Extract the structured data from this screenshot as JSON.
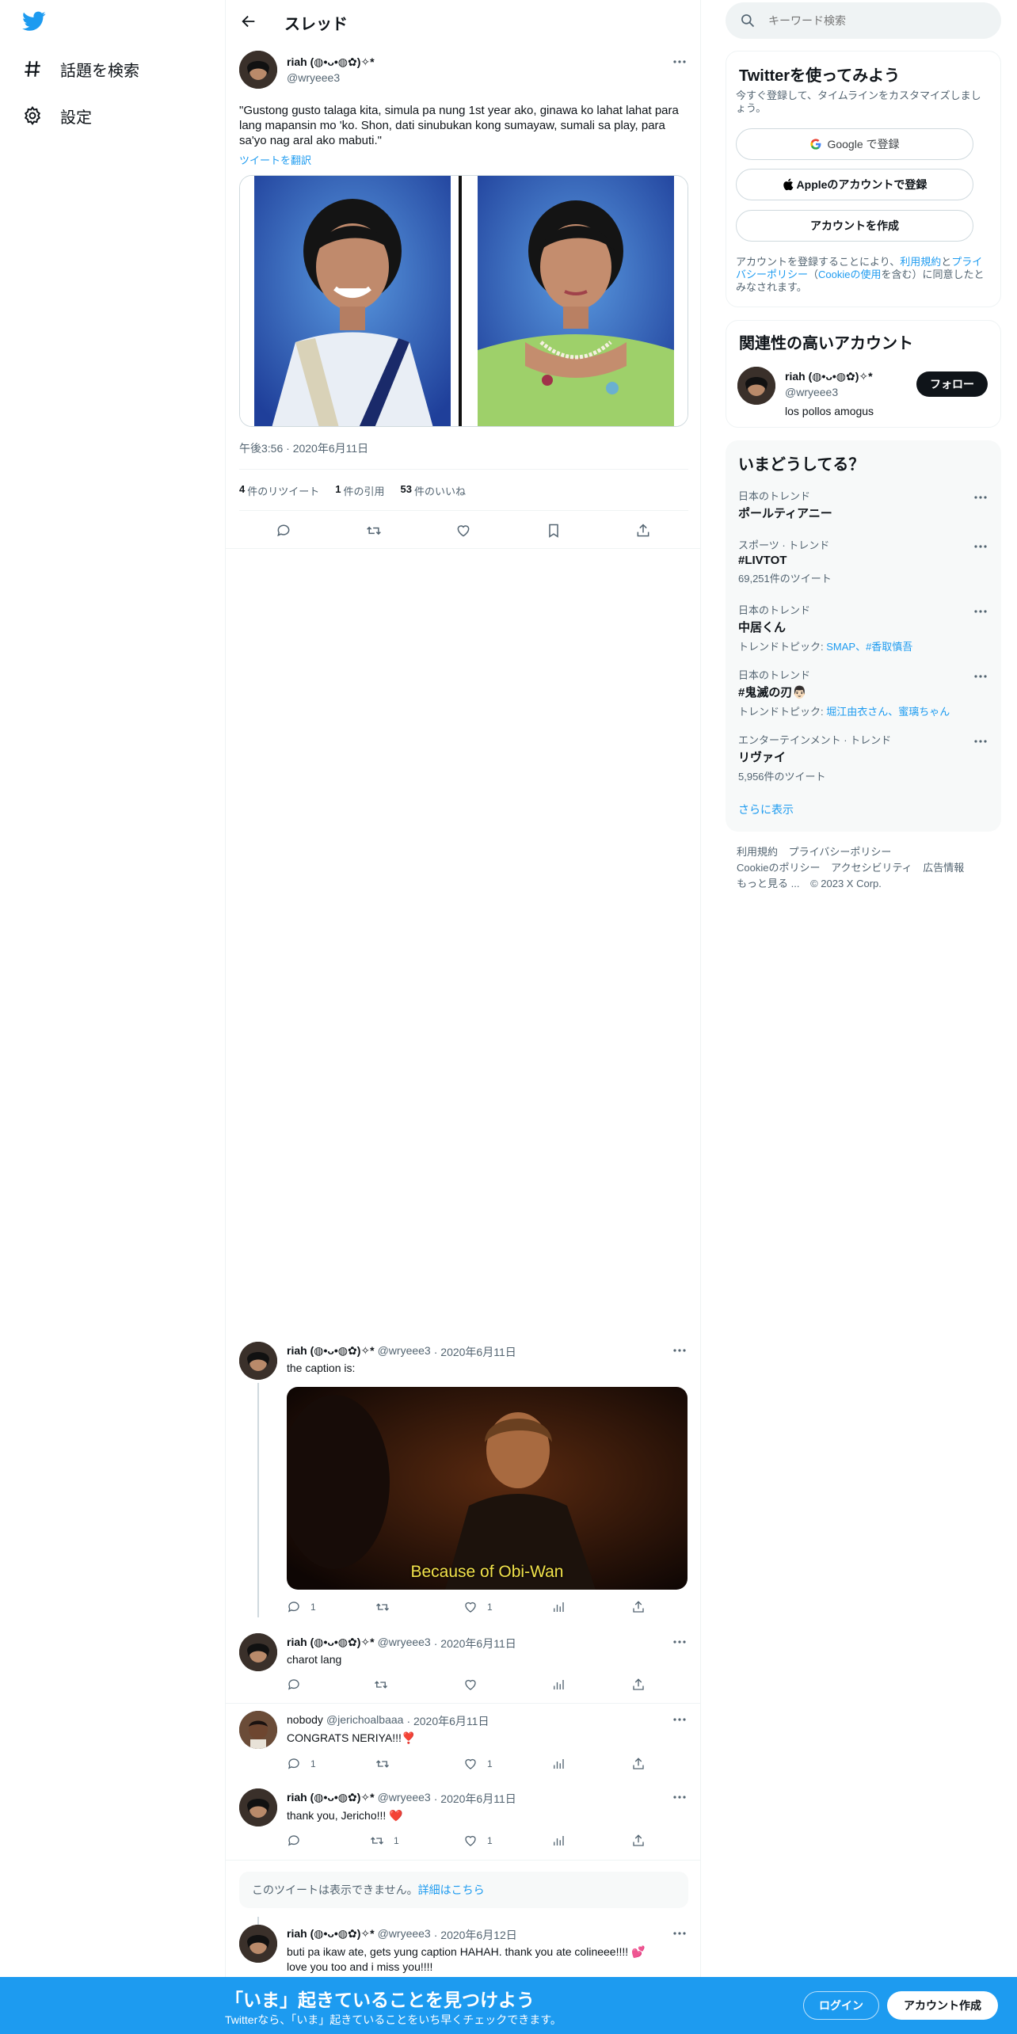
{
  "nav": {
    "explore_label": "話題を検索",
    "settings_label": "設定"
  },
  "header": {
    "title": "スレッド"
  },
  "main_tweet": {
    "name": "riah (◍•ᴗ•◍✿)✧*",
    "handle": "@wryeee3",
    "text": "\"Gustong gusto talaga kita, simula pa nung 1st year ako, ginawa ko lahat lahat para lang mapansin mo 'ko. Shon, dati sinubukan kong sumayaw, sumali sa play, para sa'yo nag aral ako mabuti.\"",
    "translate": "ツイートを翻訳",
    "timestamp": "午後3:56 · 2020年6月11日",
    "stats": {
      "retweets_count": "4",
      "retweets_label": "件のリツイート",
      "quotes_count": "1",
      "quotes_label": "件の引用",
      "likes_count": "53",
      "likes_label": "件のいいね"
    }
  },
  "replies": [
    {
      "name": "riah (◍•ᴗ•◍✿)✧*",
      "handle": "@wryeee3",
      "date": "· 2020年6月11日",
      "text": "the caption is:",
      "media_caption": "Because of Obi-Wan",
      "reply_count": "1",
      "retweet_count": "",
      "like_count": "1"
    },
    {
      "name": "riah (◍•ᴗ•◍✿)✧*",
      "handle": "@wryeee3",
      "date": "· 2020年6月11日",
      "text": "charot lang",
      "reply_count": "",
      "retweet_count": "",
      "like_count": ""
    },
    {
      "name": "nobody",
      "handle": "@jerichoalbaaa",
      "date": "· 2020年6月11日",
      "text": "CONGRATS NERIYA!!!❣️",
      "reply_count": "1",
      "retweet_count": "",
      "like_count": "1"
    },
    {
      "name": "riah (◍•ᴗ•◍✿)✧*",
      "handle": "@wryeee3",
      "date": "· 2020年6月11日",
      "text": "thank you, Jericho!!! ❤️",
      "reply_count": "",
      "retweet_count": "1",
      "like_count": "1"
    }
  ],
  "unavailable": {
    "text": "このツイートは表示できません。",
    "link": "詳細はこちら"
  },
  "last_reply": {
    "name": "riah (◍•ᴗ•◍✿)✧*",
    "handle": "@wryeee3",
    "date": "· 2020年6月12日",
    "text_line1": "buti pa ikaw ate, gets yung caption HAHAH. thank you ate colineee!!!! 💕",
    "text_line2": "love you too and i miss you!!!!"
  },
  "search": {
    "placeholder": "キーワード検索"
  },
  "signup": {
    "title": "Twitterを使ってみよう",
    "subtitle": "今すぐ登録して、タイムラインをカスタマイズしましょう。",
    "google_label": "Google で登録",
    "apple_label": "Appleのアカウントで登録",
    "create_label": "アカウントを作成",
    "legal_prefix": "アカウントを登録することにより、",
    "terms": "利用規約",
    "and": "と",
    "privacy": "プライバシーポリシー",
    "cookie_open": "（",
    "cookie": "Cookieの使用",
    "legal_suffix": "を含む）に同意したとみなされます。"
  },
  "related": {
    "title": "関連性の高いアカウント",
    "name": "riah (◍•ᴗ•◍✿)✧*",
    "handle": "@wryeee3",
    "bio": "los pollos amogus",
    "follow_label": "フォロー"
  },
  "trends": {
    "title": "いまどうしてる？",
    "items": [
      {
        "context": "日本のトレンド",
        "name": "ポールティアニー",
        "sub": ""
      },
      {
        "context": "スポーツ · トレンド",
        "name": "#LIVTOT",
        "sub": "69,251件のツイート"
      },
      {
        "context": "日本のトレンド",
        "name": "中居くん",
        "sub_prefix": "トレンドトピック: ",
        "sub_links": "SMAP、#香取慎吾"
      },
      {
        "context": "日本のトレンド",
        "name": "#鬼滅の刃👨🏻",
        "sub_prefix": "トレンドトピック: ",
        "sub_links": "堀江由衣さん、蜜璃ちゃん"
      },
      {
        "context": "エンターテインメント · トレンド",
        "name": "リヴァイ",
        "sub": "5,956件のツイート"
      }
    ],
    "show_more": "さらに表示"
  },
  "footer": {
    "terms": "利用規約",
    "privacy": "プライバシーポリシー",
    "cookie": "Cookieのポリシー",
    "accessibility": "アクセシビリティ",
    "ads": "広告情報",
    "more": "もっと見る ...",
    "copyright": "© 2023 X Corp."
  },
  "bottom_bar": {
    "headline": "「いま」起きていることを見つけよう",
    "subtext": "Twitterなら、「いま」起きていることをいち早くチェックできます。",
    "login_label": "ログイン",
    "signup_label": "アカウント作成"
  },
  "colors": {
    "accent": "#1d9bf0",
    "text": "#0f1419",
    "muted": "#536471",
    "like_heart": "#f91880"
  }
}
